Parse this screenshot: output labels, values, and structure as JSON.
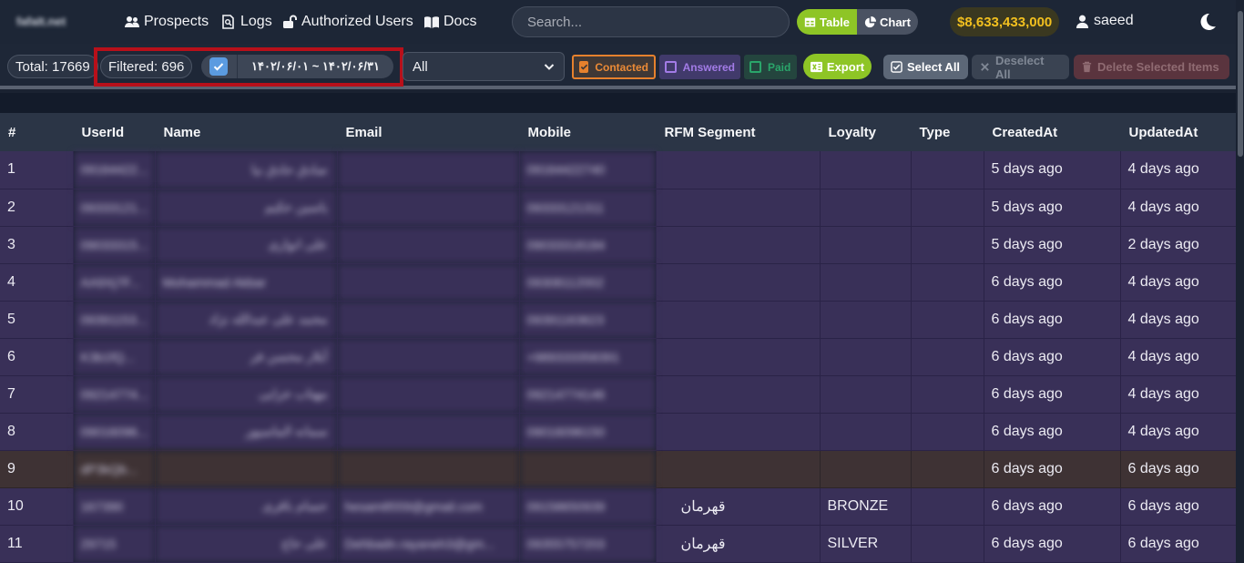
{
  "nav": {
    "brand": "fafaIt.net",
    "links": [
      {
        "label": "Prospects",
        "icon": "users-icon"
      },
      {
        "label": "Logs",
        "icon": "file-search-icon"
      },
      {
        "label": "Authorized Users",
        "icon": "unlock-icon"
      },
      {
        "label": "Docs",
        "icon": "book-icon"
      }
    ],
    "search_placeholder": "Search...",
    "view_toggle": {
      "table_label": "Table",
      "chart_label": "Chart",
      "active": "Table"
    },
    "balance": "$8,633,433,000",
    "username": "saeed",
    "theme_icon": "moon-icon"
  },
  "filters": {
    "total_label": "Total: 17669",
    "filtered_label": "Filtered: 696",
    "date_range": "۱۴۰۲/۰۶/۰۱ ~ ۱۴۰۲/۰۶/۳۱",
    "date_checked": true,
    "select_value": "All",
    "tags": {
      "contacted": "Contacted",
      "answered": "Answered",
      "paid": "Paid"
    },
    "export_label": "Export",
    "select_all_label": "Select All",
    "deselect_all_label": "Deselect All",
    "delete_label": "Delete Selected Items"
  },
  "colors": {
    "accent_green": "#8ec526",
    "balance_gold": "#f2c01f",
    "contacted_orange": "#e6812d",
    "answered_purple": "#a27be6",
    "paid_green": "#2aa56a",
    "highlight_box_red": "#b8101a",
    "row_bg": "#393058"
  },
  "table": {
    "headers": [
      "#",
      "UserId",
      "Name",
      "Email",
      "Mobile",
      "RFM Segment",
      "Loyalty",
      "Type",
      "CreatedAt",
      "UpdatedAt"
    ],
    "rows": [
      [
        "1",
        "09164422...",
        "صادق حادق نیا",
        "",
        "09164422740",
        "",
        "",
        "",
        "5 days ago",
        "4 days ago"
      ],
      [
        "2",
        "09333121...",
        "یاسین حکیم",
        "",
        "09333121311",
        "",
        "",
        "",
        "5 days ago",
        "4 days ago"
      ],
      [
        "3",
        "09033315...",
        "علی انواری",
        "",
        "09033318184",
        "",
        "",
        "",
        "5 days ago",
        "2 days ago"
      ],
      [
        "4",
        "AA9Xj7F...",
        "Mohammad Akbar",
        "",
        "09308112002",
        "",
        "",
        "",
        "6 days ago",
        "4 days ago"
      ],
      [
        "5",
        "09391153...",
        "محمد علی عبدالله نژاد",
        "",
        "09391163623",
        "",
        "",
        "",
        "6 days ago",
        "4 days ago"
      ],
      [
        "6",
        "K3b1fQ...",
        "آیلار محسن فر",
        "",
        "+989333358391",
        "",
        "",
        "",
        "6 days ago",
        "4 days ago"
      ],
      [
        "7",
        "09214774...",
        "مهتاب خزایی",
        "",
        "09214774146",
        "",
        "",
        "",
        "6 days ago",
        "4 days ago"
      ],
      [
        "8",
        "09016096...",
        "سمانه الماسپور",
        "",
        "09016096150",
        "",
        "",
        "",
        "6 days ago",
        "4 days ago"
      ],
      [
        "9",
        "dP3kQb...",
        "",
        "",
        "",
        "",
        "",
        "",
        "6 days ago",
        "6 days ago"
      ],
      [
        "10",
        "167390",
        "حسام باقری",
        "hesam8559@gmail.com",
        "09158650939",
        "قهرمان",
        "BRONZE",
        "",
        "6 days ago",
        "6 days ago"
      ],
      [
        "11",
        "29715",
        "علی حاج",
        "Dehbadn.rayaneh3@gm...",
        "09355757203",
        "قهرمان",
        "SILVER",
        "",
        "6 days ago",
        "6 days ago"
      ]
    ]
  }
}
